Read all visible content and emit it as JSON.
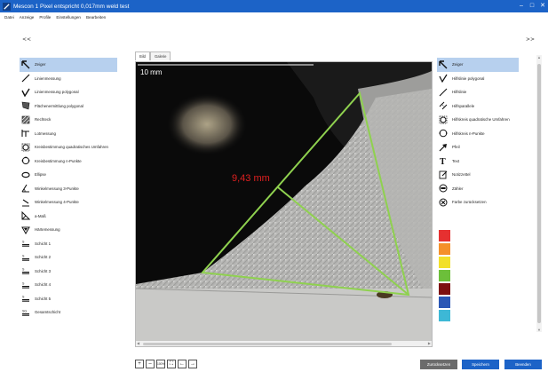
{
  "window": {
    "title": "Mescon 1 Pixel entspricht 0,017mm weld test",
    "controls": {
      "minimize": "–",
      "maximize": "□",
      "close": "✕"
    }
  },
  "menu": [
    "Datei",
    "Anzeige",
    "Profile",
    "Einstellungen",
    "Bearbeiten"
  ],
  "collapse_left": "<<",
  "collapse_right": ">>",
  "left_tools": [
    {
      "label": "Zeiger",
      "icon": "pointer-icon",
      "selected": true
    },
    {
      "label": "Linienmessung",
      "icon": "line-measure-icon"
    },
    {
      "label": "Linienmessung polygonal",
      "icon": "polyline-measure-icon"
    },
    {
      "label": "Flächenermittlung polygonal",
      "icon": "area-polygon-icon"
    },
    {
      "label": "Rechteck",
      "icon": "rectangle-icon"
    },
    {
      "label": "Lotmessung",
      "icon": "perpendicular-icon"
    },
    {
      "label": "Kreisbestimmung quadratisches Umfahren",
      "icon": "circle-square-icon"
    },
    {
      "label": "Kreisbestimmung n-Punkte",
      "icon": "circle-npoints-icon"
    },
    {
      "label": "Ellipse",
      "icon": "ellipse-icon"
    },
    {
      "label": "Winkelmessung 3-Punkte",
      "icon": "angle-3pt-icon"
    },
    {
      "label": "Winkelmessung 4-Punkte",
      "icon": "angle-4pt-icon"
    },
    {
      "label": "a-Maß",
      "icon": "a-measure-icon"
    },
    {
      "label": "Härtemessung",
      "icon": "hardness-icon"
    },
    {
      "label": "Schicht 1",
      "icon": "layer-icon"
    },
    {
      "label": "Schicht 2",
      "icon": "layer-icon"
    },
    {
      "label": "Schicht 3",
      "icon": "layer-icon"
    },
    {
      "label": "Schicht 4",
      "icon": "layer-icon"
    },
    {
      "label": "Schicht 5",
      "icon": "layer-icon"
    },
    {
      "label": "Gesamtschicht",
      "icon": "layer-total-icon"
    }
  ],
  "right_tools": [
    {
      "label": "Zeiger",
      "icon": "pointer-icon",
      "selected": true
    },
    {
      "label": "Hilfslinie polygonal",
      "icon": "aux-polyline-icon"
    },
    {
      "label": "Hilfslinie",
      "icon": "aux-line-icon"
    },
    {
      "label": "Hilfsparallele",
      "icon": "aux-parallel-icon"
    },
    {
      "label": "Hilfskreis quadratische Umfahren",
      "icon": "aux-circle-square-icon"
    },
    {
      "label": "Hilfskreis n-Punkte",
      "icon": "aux-circle-icon"
    },
    {
      "label": "Pfeil",
      "icon": "arrow-icon"
    },
    {
      "label": "Text",
      "icon": "text-icon"
    },
    {
      "label": "Notizzettel",
      "icon": "note-icon"
    },
    {
      "label": "Zähler",
      "icon": "counter-icon"
    },
    {
      "label": "Farbe zurücksetzen",
      "icon": "reset-color-icon"
    }
  ],
  "tabs": [
    {
      "label": "Bild",
      "active": true
    },
    {
      "label": "Galerie",
      "active": false
    }
  ],
  "image": {
    "scale_label": "10 mm",
    "measurement_label": "9,43 mm",
    "measure_color": "#8fd14f",
    "label_color": "#e02020"
  },
  "color_swatches": [
    "#e63030",
    "#f5902a",
    "#f2e02a",
    "#6cbf3a",
    "#7d1010",
    "#2a57b5",
    "#3db8d6"
  ],
  "zoom_buttons": [
    "+",
    "–",
    "100%",
    "⛶",
    "←",
    "→"
  ],
  "buttons": {
    "reset": "Zurücksetzen",
    "save": "Speichern",
    "exit": "Beenden"
  },
  "colors": {
    "titlebar": "#1c63c7",
    "selection": "#b7d0ee",
    "reset_button": "#6b6b6b",
    "primary_button": "#1c63c7"
  }
}
